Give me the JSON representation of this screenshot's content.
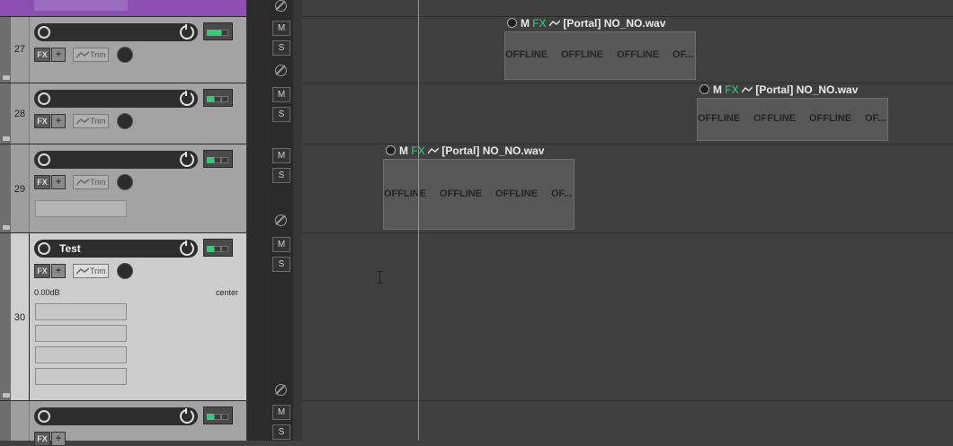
{
  "tracks": [
    {
      "number": "27",
      "name": "",
      "has_name": false
    },
    {
      "number": "28",
      "name": "",
      "has_name": false
    },
    {
      "number": "29",
      "name": "",
      "has_name": false
    },
    {
      "number": "30",
      "name": "Test",
      "has_name": true,
      "volume": "0.00dB",
      "pan": "center"
    }
  ],
  "buttons": {
    "fx": "FX",
    "plus": "+",
    "trim": "Trim",
    "mute": "M",
    "solo": "S"
  },
  "items": [
    {
      "take_label": "M",
      "fx_label": "FX",
      "name": "[Portal] NO_NO.wav",
      "offline": [
        "OFFLINE",
        "OFFLINE",
        "OFFLINE",
        "OF..."
      ]
    },
    {
      "take_label": "M",
      "fx_label": "FX",
      "name": "[Portal] NO_NO.wav",
      "offline": [
        "OFFLINE",
        "OFFLINE",
        "OFFLINE",
        "OF..."
      ]
    },
    {
      "take_label": "M",
      "fx_label": "FX",
      "name": "[Portal] NO_NO.wav",
      "offline": [
        "OFFLINE",
        "OFFLINE",
        "OFFLINE",
        "OF..."
      ]
    }
  ],
  "colors": {
    "selected_folder": "#8a4fb0",
    "playhead": "#2fc78f",
    "fx_text": "#3bd38a",
    "io_led": "#38c878"
  },
  "icons": [
    "record-arm-icon",
    "power-icon",
    "io-routing-icon",
    "envelope-icon",
    "pan-knob-icon",
    "phase-invert-icon",
    "take-volume-icon",
    "text-cursor-icon",
    "folder-icon"
  ]
}
